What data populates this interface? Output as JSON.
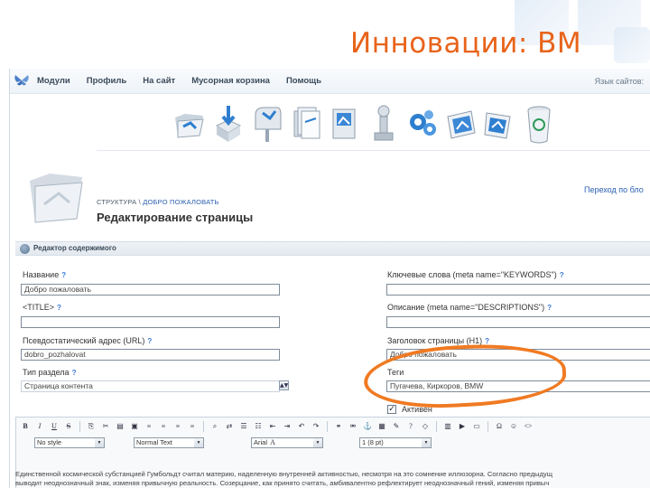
{
  "slide": {
    "title": "Инновации: ВМ"
  },
  "topbar": {
    "menu": [
      "Модули",
      "Профиль",
      "На сайт",
      "Мусорная корзина",
      "Помощь"
    ],
    "language_label": "Язык сайтов:"
  },
  "toolbar_icons": [
    "folder-icon",
    "download-box-icon",
    "mailbox-icon",
    "documents-icon",
    "image-icon",
    "lab-equipment-icon",
    "gears-icon",
    "photo-icon",
    "photo-icon",
    "trash-can-icon"
  ],
  "breadcrumb": {
    "root": "СТРУКТУРА \\",
    "current": "ДОБРО ПОЖАЛОВАТЬ"
  },
  "page_heading": "Редактирование страницы",
  "help_link": "Переход по бло",
  "panel": {
    "title": "Редактор содержимого"
  },
  "form": {
    "name_label": "Название",
    "name_value": "Добро пожаловать",
    "title_label": "<TITLE>",
    "title_value": "",
    "url_label": "Псевдостатический адрес (URL)",
    "url_value": "dobro_pozhalovat",
    "type_label": "Тип раздела",
    "type_value": "Страница контента",
    "keywords_label": "Ключевые слова (meta name=\"KEYWORDS\")",
    "keywords_value": "",
    "description_label": "Описание (meta name=\"DESCRIPTIONS\")",
    "description_value": "",
    "h1_label": "Заголовок страницы (H1)",
    "h1_value": "Добро пожаловать",
    "tags_label": "Теги",
    "tags_value": "Пугачева, Киркоров, BMW",
    "active_label": "Активен",
    "help_mark": "?"
  },
  "editor": {
    "style_select": "No style",
    "format_select": "Normal Text",
    "font_select": "Arial",
    "size_select": "1 (8 pt)",
    "line1": "Единственной космической субстанцией Гумбольдт считал материю, наделенную внутренней активностью, несмотря на это сомнение иллюзорна. Согласно предыдущ",
    "line2": "выводит неоднозначный знак, изменяя привычную реальность. Созерцание, как принято считать, амбивалентно рефлектирует неоднозначный гений, изменяя привыч"
  },
  "colors": {
    "accent": "#e8631a",
    "link": "#2a5fb0",
    "ring": "#f07a22"
  }
}
